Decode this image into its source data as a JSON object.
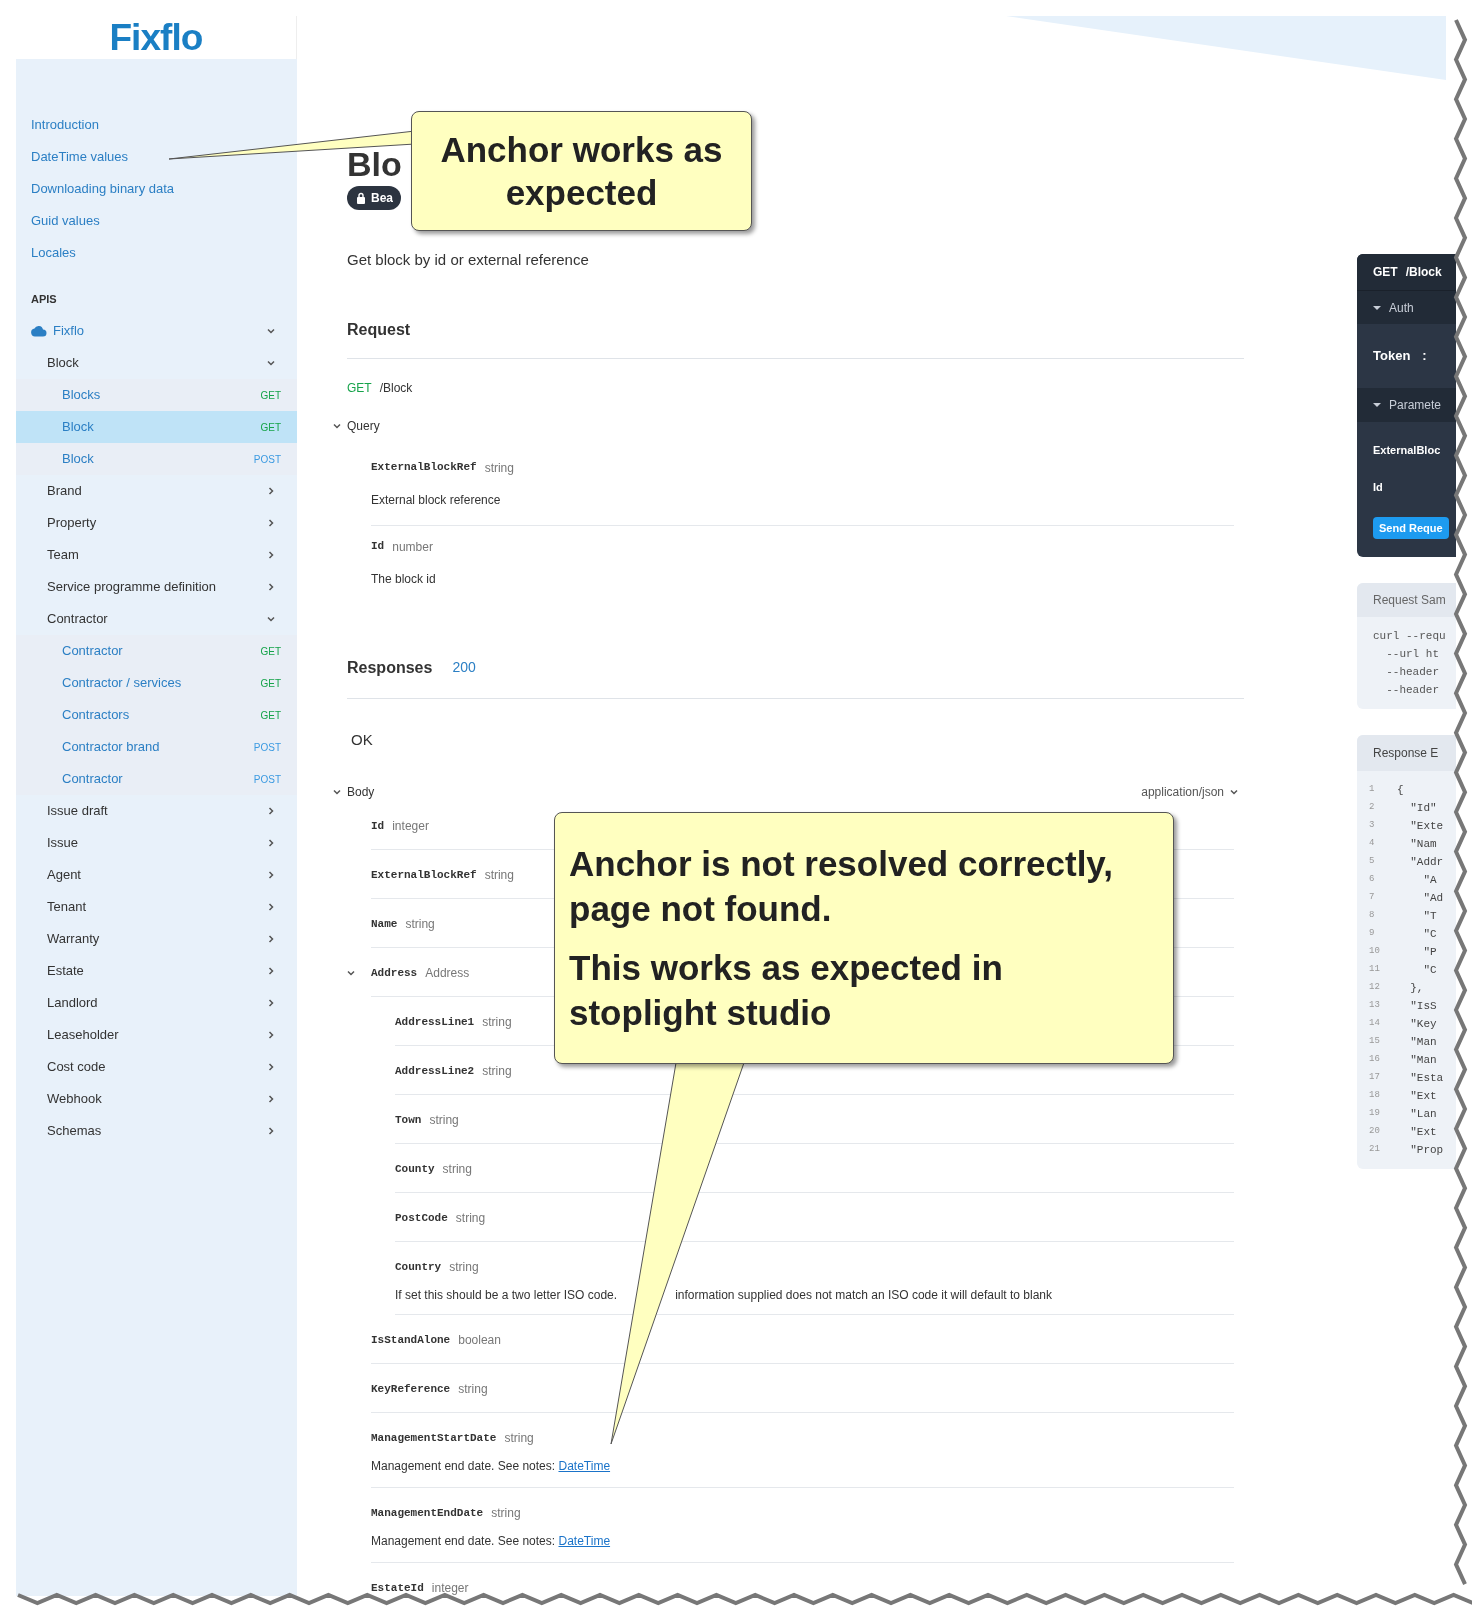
{
  "logo": "Fixflo",
  "sidebar": {
    "links": [
      "Introduction",
      "DateTime values",
      "Downloading binary data",
      "Guid values",
      "Locales"
    ],
    "section": "APIS",
    "tree": [
      {
        "kind": "service",
        "label": "Fixflo",
        "expanded": true,
        "children": [
          {
            "kind": "group",
            "label": "Block",
            "expanded": true,
            "children": [
              {
                "kind": "endpoint",
                "label": "Blocks",
                "method": "GET",
                "selected": false
              },
              {
                "kind": "endpoint",
                "label": "Block",
                "method": "GET",
                "selected": true
              },
              {
                "kind": "endpoint",
                "label": "Block",
                "method": "POST",
                "selected": false
              }
            ]
          },
          {
            "kind": "group",
            "label": "Brand",
            "expanded": false
          },
          {
            "kind": "group",
            "label": "Property",
            "expanded": false
          },
          {
            "kind": "group",
            "label": "Team",
            "expanded": false
          },
          {
            "kind": "group",
            "label": "Service programme definition",
            "expanded": false
          },
          {
            "kind": "group",
            "label": "Contractor",
            "expanded": true,
            "children": [
              {
                "kind": "endpoint",
                "label": "Contractor",
                "method": "GET",
                "selected": false
              },
              {
                "kind": "endpoint",
                "label": "Contractor / services",
                "method": "GET",
                "selected": false
              },
              {
                "kind": "endpoint",
                "label": "Contractors",
                "method": "GET",
                "selected": false
              },
              {
                "kind": "endpoint",
                "label": "Contractor brand",
                "method": "POST",
                "selected": false
              },
              {
                "kind": "endpoint",
                "label": "Contractor",
                "method": "POST",
                "selected": false
              }
            ]
          },
          {
            "kind": "group",
            "label": "Issue draft",
            "expanded": false
          },
          {
            "kind": "group",
            "label": "Issue",
            "expanded": false
          },
          {
            "kind": "group",
            "label": "Agent",
            "expanded": false
          },
          {
            "kind": "group",
            "label": "Tenant",
            "expanded": false
          },
          {
            "kind": "group",
            "label": "Warranty",
            "expanded": false
          },
          {
            "kind": "group",
            "label": "Estate",
            "expanded": false
          },
          {
            "kind": "group",
            "label": "Landlord",
            "expanded": false
          },
          {
            "kind": "group",
            "label": "Leaseholder",
            "expanded": false
          },
          {
            "kind": "group",
            "label": "Cost code",
            "expanded": false
          },
          {
            "kind": "group",
            "label": "Webhook",
            "expanded": false
          },
          {
            "kind": "group",
            "label": "Schemas",
            "expanded": false
          }
        ]
      }
    ]
  },
  "page": {
    "title": "Blo",
    "badge": "Bea",
    "description": "Get block by id or external reference",
    "request": {
      "heading": "Request",
      "method": "GET",
      "path": "/Block",
      "query": {
        "label": "Query",
        "expanded": true,
        "params": [
          {
            "name": "ExternalBlockRef",
            "type": "string",
            "description": "External block reference"
          },
          {
            "name": "Id",
            "type": "number",
            "description": "The block id"
          }
        ]
      }
    },
    "responses": {
      "heading": "Responses",
      "codes": [
        "200"
      ],
      "status": "OK",
      "body": {
        "label": "Body",
        "expanded": true,
        "content_type": "application/json",
        "fields": [
          {
            "name": "Id",
            "type": "integer"
          },
          {
            "name": "ExternalBlockRef",
            "type": "string"
          },
          {
            "name": "Name",
            "type": "string"
          },
          {
            "name": "Address",
            "type": "Address",
            "expanded": true,
            "children": [
              {
                "name": "AddressLine1",
                "type": "string"
              },
              {
                "name": "AddressLine2",
                "type": "string"
              },
              {
                "name": "Town",
                "type": "string"
              },
              {
                "name": "County",
                "type": "string"
              },
              {
                "name": "PostCode",
                "type": "string"
              },
              {
                "name": "Country",
                "type": "string",
                "description_parts": [
                  "If set this should be a two letter ISO code.",
                  "information supplied does not match an ISO code it will default to blank"
                ]
              }
            ]
          },
          {
            "name": "IsStandAlone",
            "type": "boolean"
          },
          {
            "name": "KeyReference",
            "type": "string"
          },
          {
            "name": "ManagementStartDate",
            "type": "string",
            "description": "Management end date. See notes:",
            "link": "DateTime"
          },
          {
            "name": "ManagementEndDate",
            "type": "string",
            "description": "Management end date. See notes:",
            "link": "DateTime"
          },
          {
            "name": "EstateId",
            "type": "integer"
          }
        ]
      }
    }
  },
  "try_it": {
    "method": "GET",
    "path": "/Block",
    "auth": {
      "label": "Auth",
      "expanded": true
    },
    "token_label": "Token",
    "token_sep": ":",
    "parameters": {
      "label": "Paramete",
      "expanded": true
    },
    "params": [
      "ExternalBloc",
      "Id"
    ],
    "send": "Send Reque"
  },
  "request_sample": {
    "title": "Request Sam",
    "lines": [
      "curl --requ",
      "  --url ht",
      "  --header",
      "  --header"
    ]
  },
  "response_example": {
    "title": "Response E",
    "lines": [
      {
        "n": "1",
        "code": "{"
      },
      {
        "n": "2",
        "code": "  \"Id\""
      },
      {
        "n": "3",
        "code": "  \"Exte"
      },
      {
        "n": "4",
        "code": "  \"Nam"
      },
      {
        "n": "5",
        "code": "  \"Addr"
      },
      {
        "n": "6",
        "code": "    \"A"
      },
      {
        "n": "7",
        "code": "    \"Ad"
      },
      {
        "n": "8",
        "code": "    \"T"
      },
      {
        "n": "9",
        "code": "    \"C"
      },
      {
        "n": "10",
        "code": "    \"P"
      },
      {
        "n": "11",
        "code": "    \"C"
      },
      {
        "n": "12",
        "code": "  },"
      },
      {
        "n": "13",
        "code": "  \"IsS"
      },
      {
        "n": "14",
        "code": "  \"Key"
      },
      {
        "n": "15",
        "code": "  \"Man"
      },
      {
        "n": "16",
        "code": "  \"Man"
      },
      {
        "n": "17",
        "code": "  \"Esta"
      },
      {
        "n": "18",
        "code": "  \"Ext"
      },
      {
        "n": "19",
        "code": "  \"Lan"
      },
      {
        "n": "20",
        "code": "  \"Ext"
      },
      {
        "n": "21",
        "code": "  \"Prop"
      }
    ]
  },
  "callouts": [
    {
      "paragraphs": [
        "Anchor works as expected"
      ]
    },
    {
      "paragraphs": [
        "Anchor is not resolved correctly, page not found.",
        "This works as expected in stoplight studio"
      ]
    }
  ]
}
